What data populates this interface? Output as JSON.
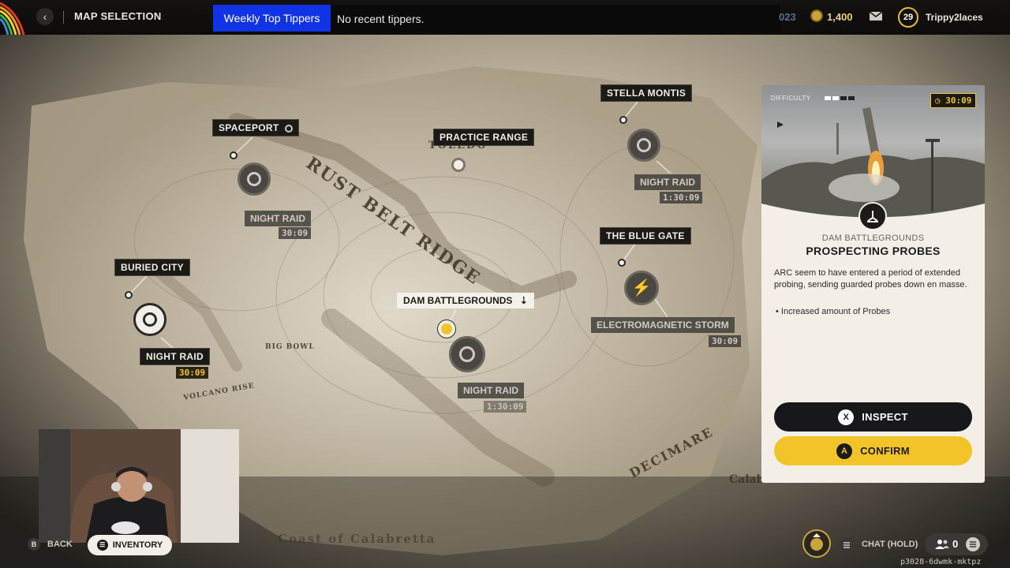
{
  "topbar": {
    "title": "MAP SELECTION",
    "tipper_label": "Weekly Top Tippers",
    "tipper_text": "No recent tippers.",
    "stat_partial": "023",
    "coins": "1,400",
    "level": "29",
    "username": "Trippy2laces"
  },
  "map": {
    "locations": {
      "spaceport": {
        "name": "SPACEPORT",
        "condition": "NIGHT RAID",
        "timer": "30:09"
      },
      "practice_range": {
        "name": "PRACTICE RANGE"
      },
      "stella_montis": {
        "name": "STELLA MONTIS",
        "condition": "NIGHT RAID",
        "timer": "1:30:09"
      },
      "the_blue_gate": {
        "name": "THE BLUE GATE",
        "condition": "ELECTROMAGNETIC STORM",
        "timer": "30:09"
      },
      "buried_city": {
        "name": "BURIED CITY",
        "condition": "NIGHT RAID",
        "timer": "30:09"
      },
      "dam_battlegrounds": {
        "name": "DAM BATTLEGROUNDS",
        "condition": "NIGHT RAID",
        "timer": "1:30:09"
      }
    },
    "region_labels": [
      "RUST BELT RIDGE",
      "TOLEDO",
      "DECIMARE",
      "Coast of Calabretta",
      "BIG BOWL",
      "VOLCANO RISE",
      "Calabretta"
    ]
  },
  "panel": {
    "difficulty_label": "DIFFICULTY",
    "timer": "30:09",
    "map_name": "DAM BATTLEGROUNDS",
    "title": "PROSPECTING PROBES",
    "description": "ARC seem to have entered a period of extended probing, sending guarded probes down en masse.",
    "bullet": "Increased amount of Probes",
    "inspect_label": "INSPECT",
    "inspect_glyph": "X",
    "confirm_label": "CONFIRM",
    "confirm_glyph": "A"
  },
  "bottom": {
    "back_glyph": "B",
    "back_label": "BACK",
    "inventory_label": "INVENTORY",
    "chat_label": "CHAT (HOLD)",
    "party_count": "0",
    "session_id": "p3028-6dwmk-mktpz"
  },
  "colors": {
    "accent_yellow": "#f2c429",
    "tipper_blue": "#1033e6",
    "panel_bg": "#f3efe7"
  }
}
